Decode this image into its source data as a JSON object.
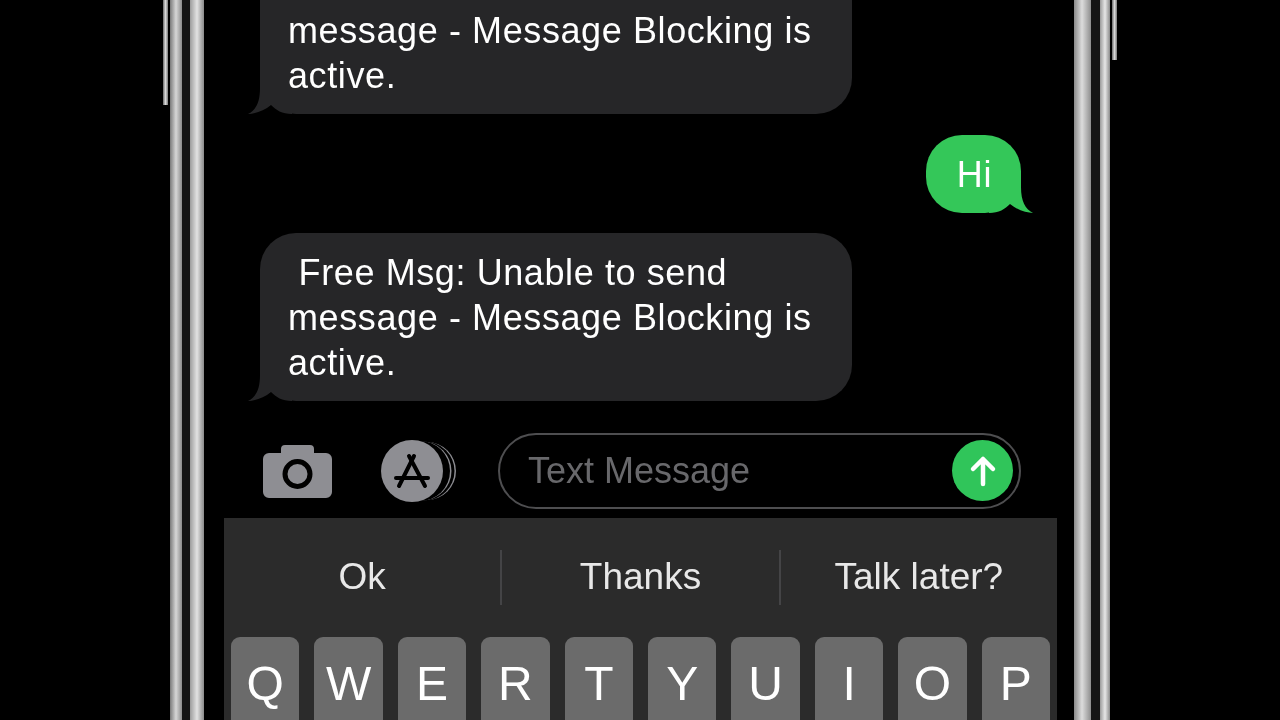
{
  "messages": [
    {
      "kind": "received",
      "text": "message - Message Blocking is active."
    },
    {
      "kind": "sent",
      "text": "Hi"
    },
    {
      "kind": "received",
      "text": " Free Msg: Unable to send message - Message Blocking is active."
    }
  ],
  "composer": {
    "placeholder": "Text Message"
  },
  "suggestions": [
    "Ok",
    "Thanks",
    "Talk later?"
  ],
  "keys": [
    "Q",
    "W",
    "E",
    "R",
    "T",
    "Y",
    "U",
    "I",
    "O",
    "P"
  ]
}
